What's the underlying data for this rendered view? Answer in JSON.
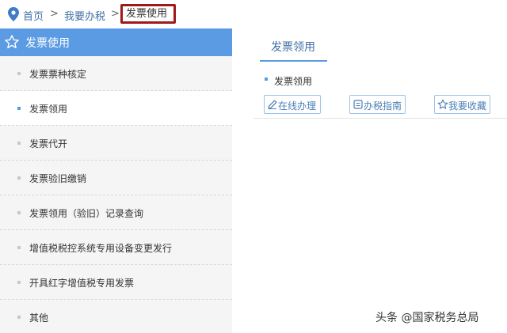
{
  "breadcrumb": {
    "home": "首页",
    "separator": ">",
    "level2": "我要办税",
    "current": "发票使用"
  },
  "sidebar": {
    "title": "发票使用",
    "items": [
      {
        "label": "发票票种核定"
      },
      {
        "label": "发票领用"
      },
      {
        "label": "发票代开"
      },
      {
        "label": "发票验旧缴销"
      },
      {
        "label": "发票领用（验旧）记录查询"
      },
      {
        "label": "增值税税控系统专用设备变更发行"
      },
      {
        "label": "开具红字增值税专用发票"
      },
      {
        "label": "其他"
      }
    ],
    "active_index": 1
  },
  "main": {
    "tab": "发票领用",
    "item": "发票领用",
    "actions": {
      "online": "在线办理",
      "guide": "办税指南",
      "favorite": "我要收藏"
    }
  },
  "watermark": "头条 @国家税务总局",
  "colors": {
    "accent": "#5b9be3",
    "link": "#3f6fa6",
    "highlight_border": "#a01919",
    "sidebar_bg": "#f5f5f5"
  }
}
